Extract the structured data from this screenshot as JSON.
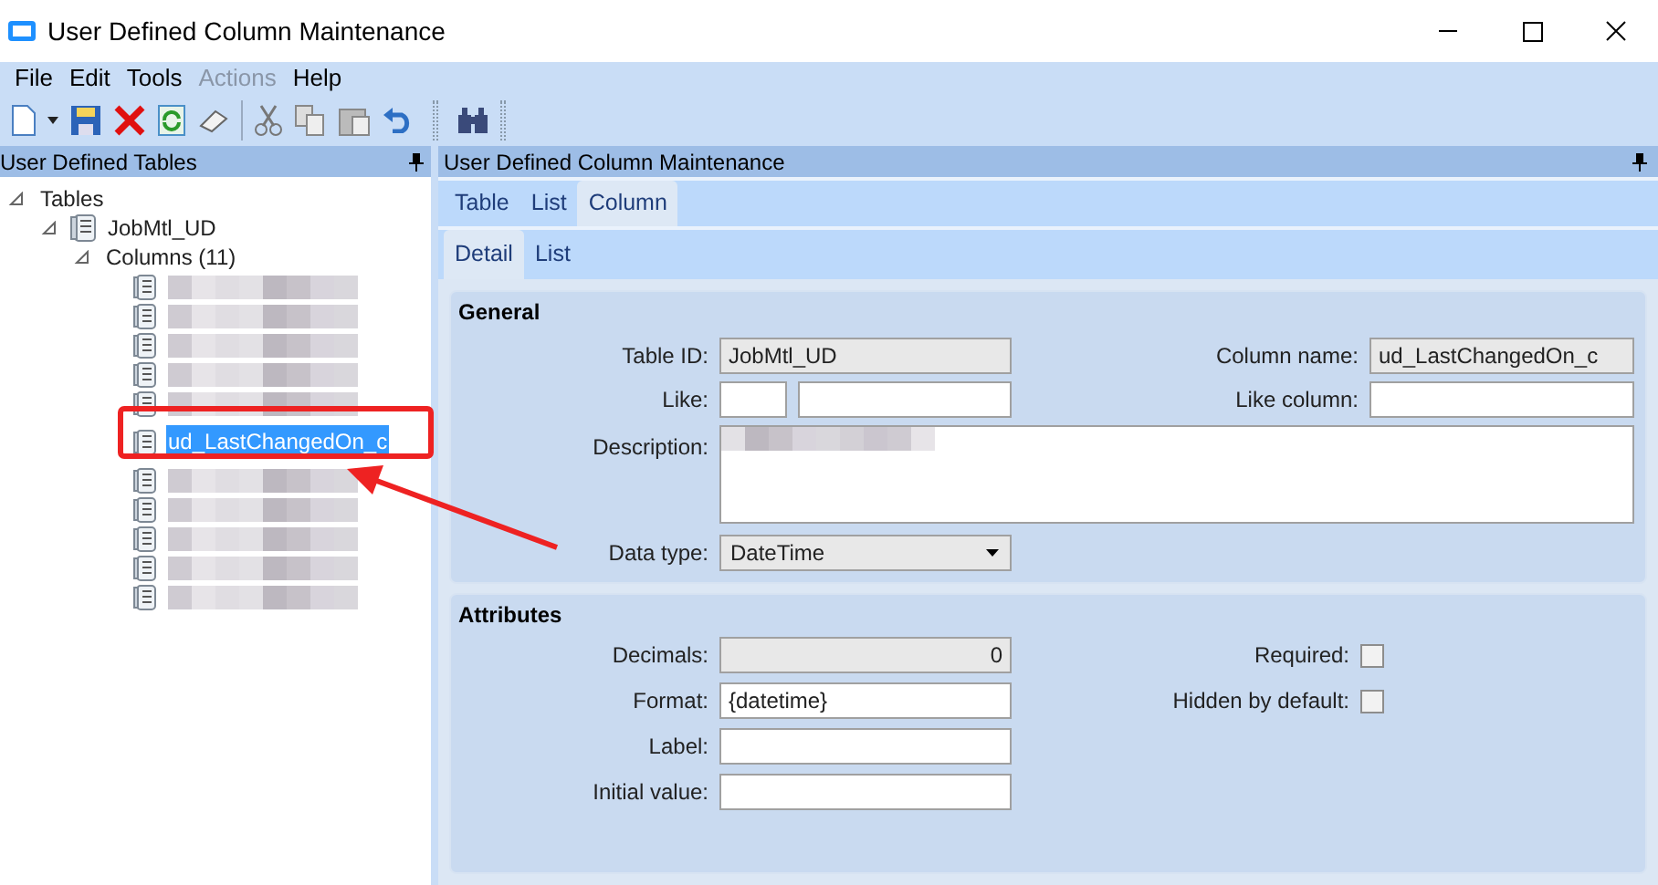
{
  "window": {
    "title": "User Defined Column Maintenance"
  },
  "menu": [
    {
      "label": "File",
      "disabled": false
    },
    {
      "label": "Edit",
      "disabled": false
    },
    {
      "label": "Tools",
      "disabled": false
    },
    {
      "label": "Actions",
      "disabled": true
    },
    {
      "label": "Help",
      "disabled": false
    }
  ],
  "left_panel": {
    "title": "User Defined Tables",
    "tree": [
      {
        "label": "Tables",
        "expanded": true,
        "kind": "folder",
        "children": [
          {
            "label": "JobMtl_UD",
            "expanded": true,
            "kind": "table",
            "children": [
              {
                "label": "Columns (11)",
                "expanded": true,
                "kind": "folder",
                "children": [
                  {
                    "label": "ud_LastChangedOn_c",
                    "kind": "column",
                    "selected": true
                  }
                ]
              }
            ]
          }
        ]
      }
    ]
  },
  "right_panel": {
    "title": "User Defined Column Maintenance",
    "tabs": [
      {
        "label": "Table",
        "selected": false
      },
      {
        "label": "List",
        "selected": false
      },
      {
        "label": "Column",
        "selected": true
      }
    ],
    "subtabs": [
      {
        "label": "Detail",
        "selected": true
      },
      {
        "label": "List",
        "selected": false
      }
    ],
    "general": {
      "title": "General",
      "table_id": {
        "label": "Table ID:",
        "value": "JobMtl_UD",
        "readonly": true
      },
      "like": {
        "label": "Like:"
      },
      "column_name": {
        "label": "Column name:",
        "value": "ud_LastChangedOn_c",
        "readonly": true
      },
      "like_column": {
        "label": "Like column:"
      },
      "description": {
        "label": "Description:"
      },
      "data_type": {
        "label": "Data type:",
        "value": "DateTime"
      }
    },
    "attributes": {
      "title": "Attributes",
      "decimals": {
        "label": "Decimals:",
        "value": "0",
        "readonly": true
      },
      "format": {
        "label": "Format:",
        "value": "{datetime}",
        "readonly": false
      },
      "label": {
        "label": "Label:"
      },
      "initial_value": {
        "label": "Initial value:"
      },
      "required": {
        "label": "Required:",
        "checked": false
      },
      "hidden_by_default": {
        "label": "Hidden by default:",
        "checked": false
      }
    }
  }
}
